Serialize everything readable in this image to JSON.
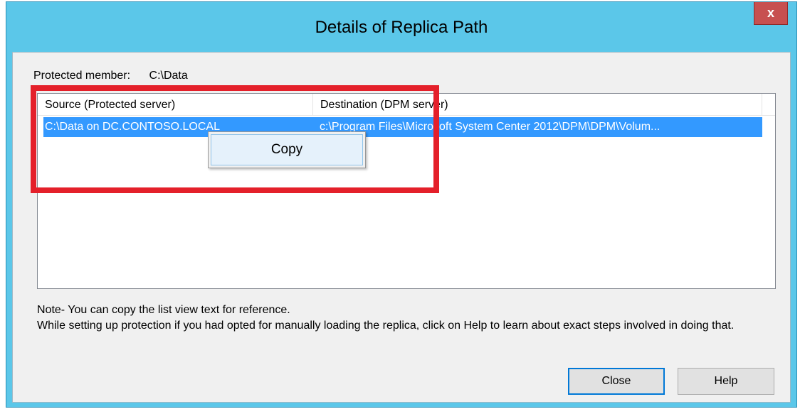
{
  "window": {
    "title": "Details of Replica Path",
    "close_glyph": "x"
  },
  "protected": {
    "label": "Protected member:",
    "value": "C:\\Data"
  },
  "listview": {
    "columns": [
      "Source (Protected server)",
      "Destination (DPM server)"
    ],
    "rows": [
      {
        "source": "C:\\Data on DC.CONTOSO.LOCAL",
        "destination": "c:\\Program Files\\Microsoft System Center 2012\\DPM\\DPM\\Volum..."
      }
    ],
    "selected_row_color": "#3399ff"
  },
  "context_menu": {
    "items": [
      "Copy"
    ]
  },
  "note": {
    "line1": "Note- You can copy the list view text for reference.",
    "line2": "While setting up protection if you had opted for manually loading the replica, click on Help to learn about exact steps involved in doing that."
  },
  "buttons": {
    "close": "Close",
    "help": "Help"
  },
  "colors": {
    "titlebar": "#5bc7e9",
    "close_x": "#c75050",
    "highlight": "#e4202a"
  }
}
